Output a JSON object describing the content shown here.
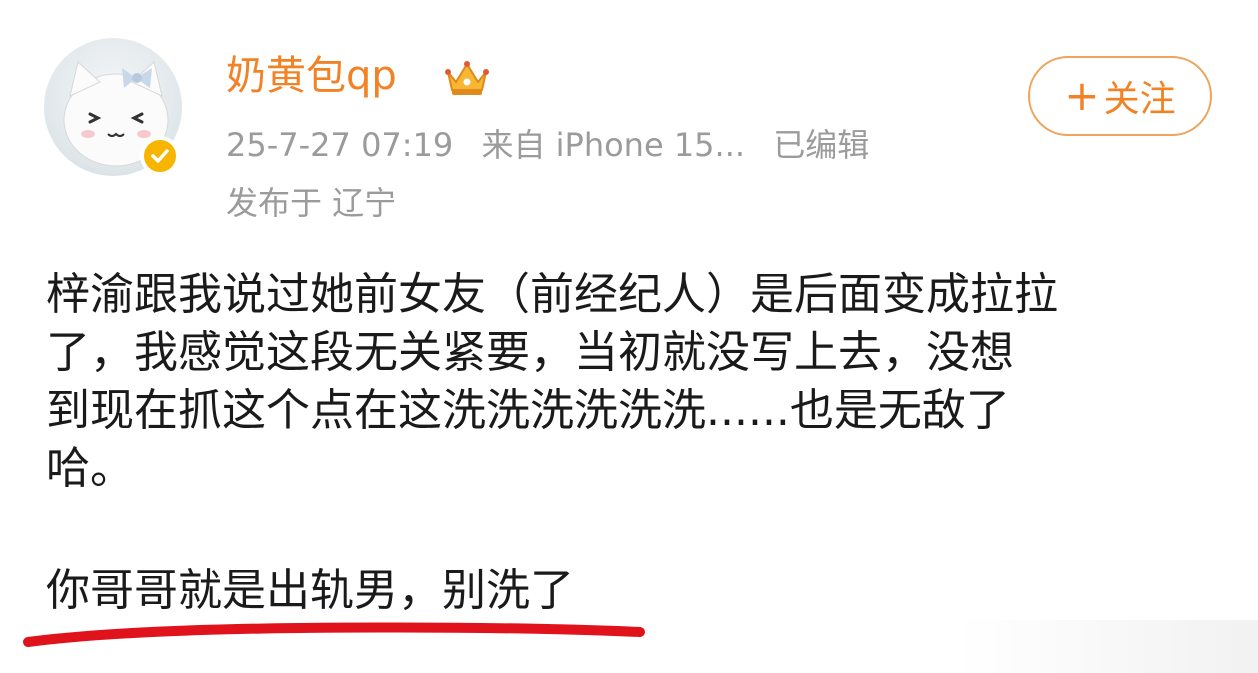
{
  "user": {
    "name": "奶黄包qp",
    "avatar_icon": "cat-avatar-icon",
    "verified_icon": "verified-check-icon",
    "badge_icon": "crown-badge-icon"
  },
  "meta": {
    "timestamp": "25-7-27 07:19",
    "source": "来自 iPhone 15...",
    "edited": "已编辑",
    "location": "发布于 辽宁"
  },
  "follow": {
    "label": "关注",
    "plus": "+"
  },
  "post": {
    "lines": [
      "梓渝跟我说过她前女友（前经纪人）是后面变成拉拉",
      "了，我感觉这段无关紧要，当初就没写上去，没想",
      "到现在抓这个点在这洗洗洗洗洗洗......也是无敌了",
      "哈。"
    ],
    "highlight": "你哥哥就是出轨男，别洗了"
  },
  "colors": {
    "name": "#f28226",
    "meta": "#9b9b9b",
    "text": "#1a1a1a",
    "underline": "#e0121b",
    "verified": "#f7b500"
  }
}
